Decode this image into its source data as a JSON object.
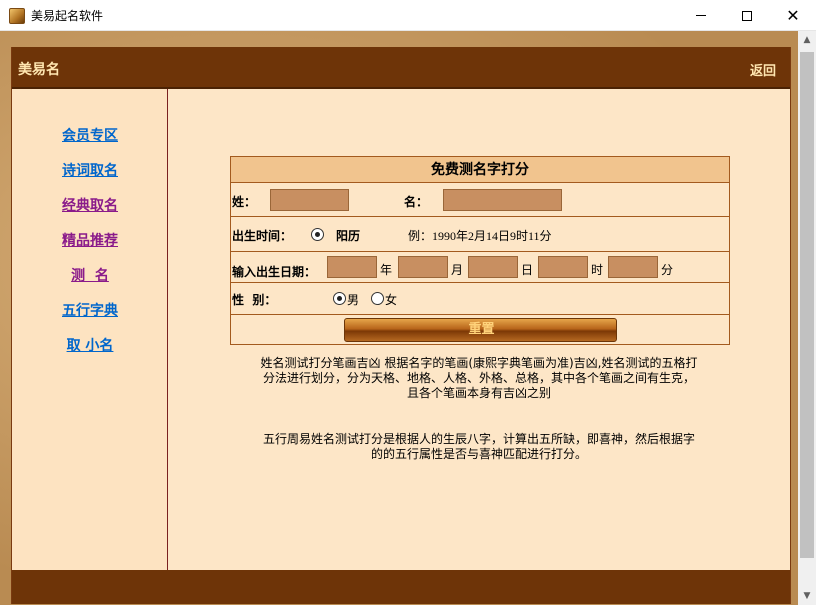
{
  "window": {
    "title": "美易起名软件",
    "icons": [
      "app-icon",
      "minimize-icon",
      "maximize-icon",
      "close-icon"
    ]
  },
  "header": {
    "brand": "美易名",
    "back": "返回"
  },
  "sidebar": {
    "items": [
      {
        "label": "会员专区"
      },
      {
        "label": "诗词取名"
      },
      {
        "label": "经典取名"
      },
      {
        "label": "精品推荐"
      },
      {
        "label": "测  名"
      },
      {
        "label": "五行字典"
      },
      {
        "label": "取 小名"
      }
    ]
  },
  "form": {
    "title": "免费测名字打分",
    "surname_label": "姓：",
    "name_label": "名：",
    "surname_value": "",
    "name_value": "",
    "birth_time_label": "出生时间：",
    "calendar_option": "阳历",
    "example": "例：1990年2月14日9时11分",
    "birth_date_label": "输入出生日期：",
    "unit_year": "年",
    "unit_month": "月",
    "unit_day": "日",
    "unit_hour": "时",
    "unit_minute": "分",
    "gender_label": "性  别：",
    "gender_male": "男",
    "gender_female": "女",
    "selected_gender": "男",
    "reset_label": "重置"
  },
  "descriptions": {
    "p1_line1": "姓名测试打分笔画吉凶 根据名字的笔画(康熙字典笔画为准)吉凶,姓名测试的五格打",
    "p1_line2": "分法进行划分，分为天格、地格、人格、外格、总格，其中各个笔画之间有生克，",
    "p1_line3": "且各个笔画本身有吉凶之别",
    "p2_line1": "五行周易姓名测试打分是根据人的生辰八字，计算出五所缺，即喜神，然后根据字",
    "p2_line2": "的的五行属性是否与喜神匹配进行打分。"
  },
  "colors": {
    "header": "#6e3408",
    "panel": "#fde6c7",
    "form_title": "#f1c48e",
    "input": "#c88f61",
    "link": "#1565b0",
    "link_visited": "#8a1a8a"
  }
}
